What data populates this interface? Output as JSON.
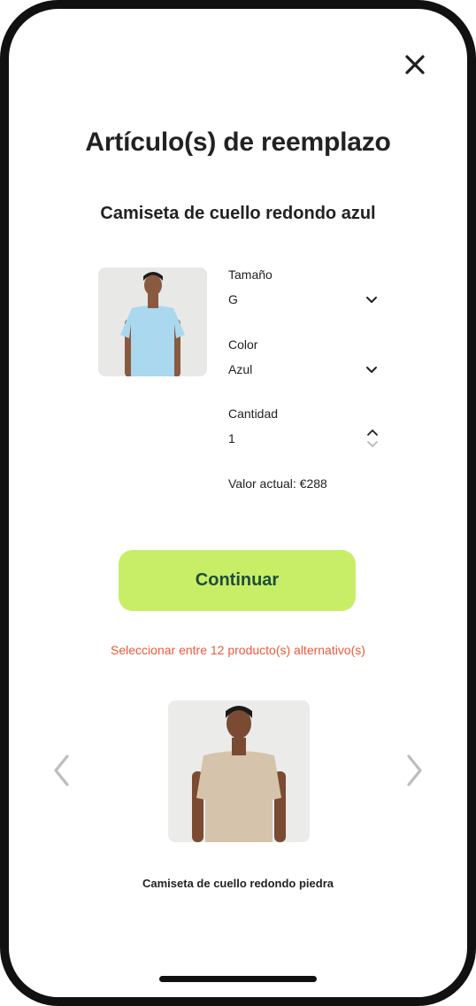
{
  "header": {
    "title": "Artículo(s) de reemplazo"
  },
  "product": {
    "name": "Camiseta de cuello redondo azul",
    "shirt_color": "#a9d8ef"
  },
  "fields": {
    "size_label": "Tamaño",
    "size_value": "G",
    "color_label": "Color",
    "color_value": "Azul",
    "quantity_label": "Cantidad",
    "quantity_value": "1",
    "current_value": "Valor actual: €288"
  },
  "actions": {
    "continue_label": "Continuar",
    "alternatives_link": "Seleccionar entre 12 producto(s) alternativo(s)"
  },
  "alternative": {
    "name": "Camiseta de cuello redondo piedra",
    "shirt_color": "#d6c3ab"
  },
  "colors": {
    "accent_button": "#c8ee68",
    "button_text": "#1d4d3a",
    "link": "#ec5a3a"
  },
  "icons": {
    "close": "close-icon",
    "dropdown": "chevron-down-icon",
    "stepper": "stepper-icon",
    "prev": "chevron-left-icon",
    "next": "chevron-right-icon"
  }
}
